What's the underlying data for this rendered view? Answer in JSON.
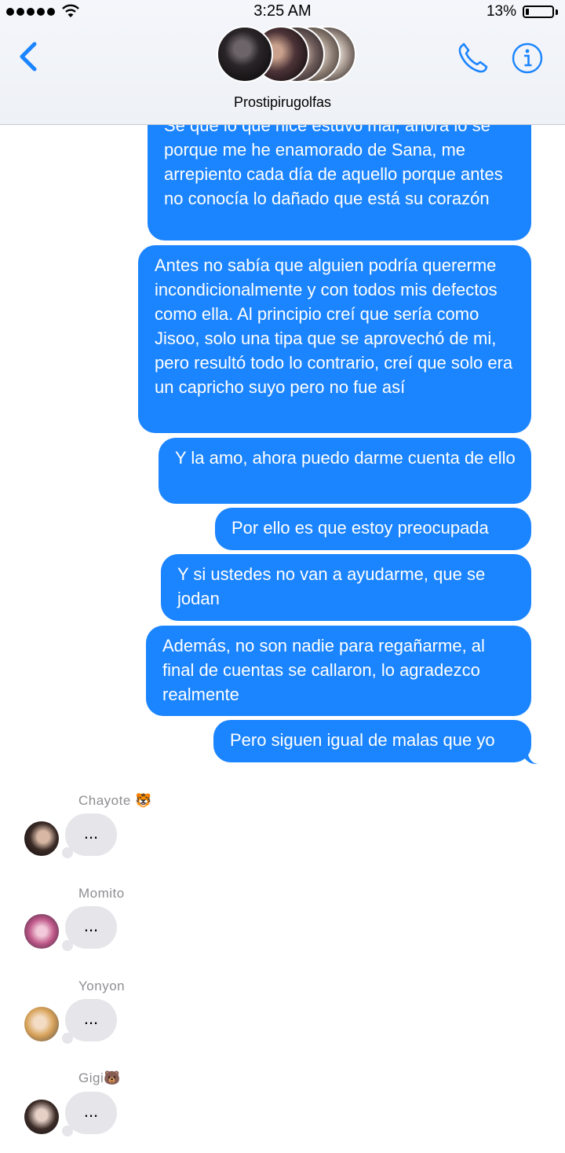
{
  "status_bar": {
    "time": "3:25 AM",
    "battery_percent": "13%",
    "battery_level": 0.13,
    "signal_bars": 5
  },
  "header": {
    "group_name": "Prostipirugolfas",
    "back_icon": "chevron-left-icon",
    "call_icon": "phone-icon",
    "info_icon": "info-icon",
    "accent_color": "#1b84ff"
  },
  "messages": [
    {
      "text": "Sé que lo que hice estuvo mal, ahora lo sé porque me he enamorado de Sana, me arrepiento cada día de aquello porque antes no conocía lo dañado que está su corazón"
    },
    {
      "text": "Antes no sabía que alguien podría quererme incondicionalmente y con todos mis defectos como ella. Al principio creí que sería como Jisoo, solo una tipa que se aprovechó de mi, pero resultó todo lo contrario, creí que solo era un capricho suyo pero no fue así"
    },
    {
      "text": "Y la amo, ahora puedo darme cuenta de ello"
    },
    {
      "text": "Por ello es que estoy preocupada"
    },
    {
      "text": "Y si ustedes no van a ayudarme, que se jodan"
    },
    {
      "text": "Además, no son nadie para regañarme, al final de cuentas se callaron, lo agradezco realmente"
    },
    {
      "text": "Pero siguen igual de malas que yo"
    }
  ],
  "typing": [
    {
      "name": "Chayote 🐯",
      "indicator": "..."
    },
    {
      "name": "Momito",
      "indicator": "..."
    },
    {
      "name": "Yonyon",
      "indicator": "..."
    },
    {
      "name": "Gigi🐻",
      "indicator": "..."
    }
  ]
}
